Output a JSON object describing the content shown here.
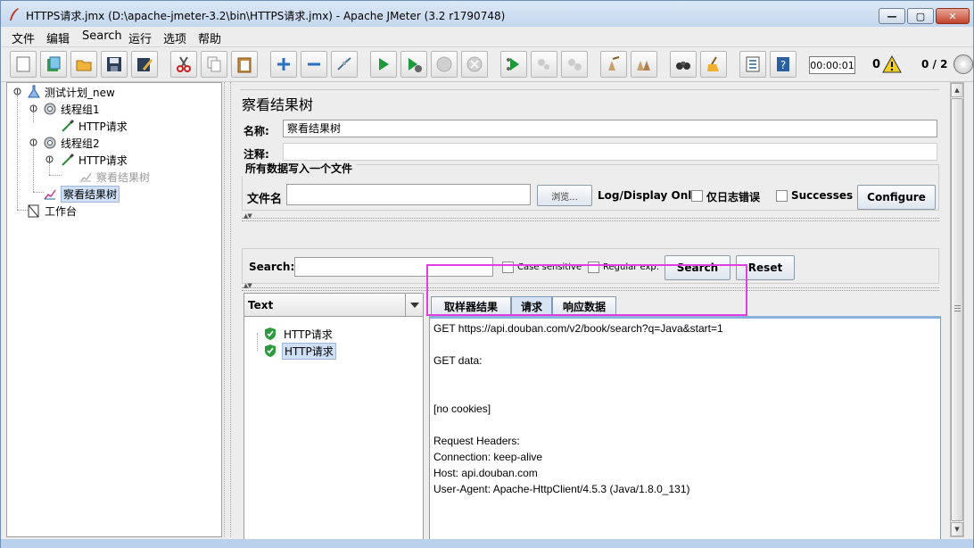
{
  "window": {
    "title": "HTTPS请求.jmx (D:\\apache-jmeter-3.2\\bin\\HTTPS请求.jmx) - Apache JMeter (3.2 r1790748)",
    "min_glyph": "—",
    "max_glyph": "▢",
    "close_glyph": "✕"
  },
  "menu": [
    "文件",
    "编辑",
    "Search",
    "运行",
    "选项",
    "帮助"
  ],
  "toolbar": {
    "icons": [
      "new-icon",
      "templates-icon",
      "open-icon",
      "save-icon",
      "save-as-icon",
      "cut-icon",
      "copy-icon",
      "paste-icon",
      "expand-icon",
      "collapse-icon",
      "toggle-icon",
      "start-icon",
      "start-no-pause-icon",
      "stop-icon",
      "shutdown-icon",
      "remote-start-icon",
      "remote-stop-icon",
      "remote-shutdown-icon",
      "clear-icon",
      "clear-all-icon",
      "search-binoculars-icon",
      "reset-search-broom-icon",
      "function-helper-icon",
      "help-icon"
    ],
    "timer": "00:00:01",
    "error_count": "0",
    "threads": "0 / 2"
  },
  "tree": {
    "nodes": [
      {
        "label": "测试计划_new",
        "icon": "test-plan-icon"
      },
      {
        "label": "线程组1",
        "icon": "thread-group-icon"
      },
      {
        "label": "HTTP请求",
        "icon": "sampler-pipette-icon"
      },
      {
        "label": "线程组2",
        "icon": "thread-group-icon"
      },
      {
        "label": "HTTP请求",
        "icon": "sampler-pipette-icon"
      },
      {
        "label": "察看结果树",
        "icon": "listener-icon",
        "disabled": true
      },
      {
        "label": "察看结果树",
        "icon": "listener-icon",
        "selected": true
      },
      {
        "label": "工作台",
        "icon": "workbench-icon"
      }
    ]
  },
  "panel": {
    "title": "察看结果树",
    "name_label": "名称:",
    "name_value": "察看结果树",
    "comment_label": "注释:",
    "comment_value": "",
    "file_group_title": "所有数据写入一个文件",
    "filename_label": "文件名",
    "filename_value": "",
    "browse_label": "浏览...",
    "log_display_label": "Log/Display Only:",
    "errors_only_label": "仅日志错误",
    "successes_label": "Successes",
    "configure_label": "Configure"
  },
  "search": {
    "label": "Search:",
    "value": "",
    "case_sensitive_label": "Case sensitive",
    "regex_label": "Regular exp.",
    "search_button": "Search",
    "reset_button": "Reset"
  },
  "results": {
    "renderer": "Text",
    "items": [
      {
        "label": "HTTP请求",
        "status": "success"
      },
      {
        "label": "HTTP请求",
        "status": "success",
        "selected": true
      }
    ]
  },
  "tabs": [
    "取样器结果",
    "请求",
    "响应数据"
  ],
  "active_tab": "请求",
  "request_lines": [
    "GET https://api.douban.com/v2/book/search?q=Java&start=1",
    "",
    "GET data:",
    "",
    "",
    "[no cookies]",
    "",
    "Request Headers:",
    "Connection: keep-alive",
    "Host: api.douban.com",
    "User-Agent: Apache-HttpClient/4.5.3 (Java/1.8.0_131)"
  ],
  "colors": {
    "highlight": "#e040e0",
    "selection": "#cfe0f6",
    "success_shield": "#2e9a3e"
  }
}
